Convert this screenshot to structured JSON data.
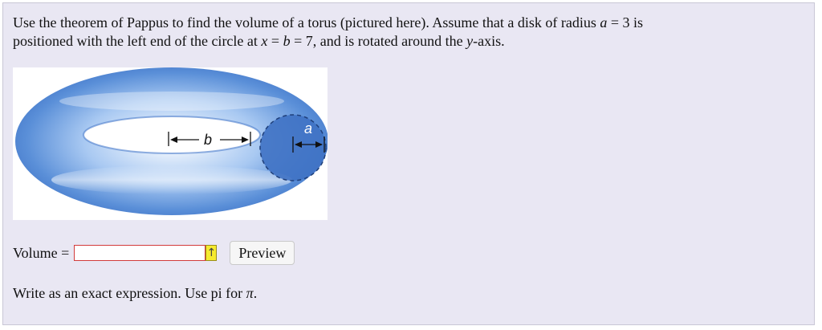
{
  "question": {
    "p1": "Use the theorem of Pappus to find the volume of a torus (pictured here). Assume that a disk of radius ",
    "a_var": "a",
    "eq1": " = 3 is",
    "p2": "positioned with the left end of the circle at ",
    "x_var": "x",
    "eq2_a": " = ",
    "b_var": "b",
    "eq2_b": " = 7, and is rotated around the ",
    "y_var": "y",
    "p3": "-axis."
  },
  "figure": {
    "label_b": "b",
    "label_a": "a",
    "colors": {
      "torus_dark": "#3a6fc6",
      "torus_light": "#d2e4fb",
      "cross_section": "#3f72c4"
    }
  },
  "answer": {
    "label": "Volume =",
    "value": "",
    "flag_icon": "↑",
    "preview_label": "Preview"
  },
  "hint": {
    "text": "Write as an exact expression. Use pi for ",
    "pi": "π",
    "end": "."
  }
}
